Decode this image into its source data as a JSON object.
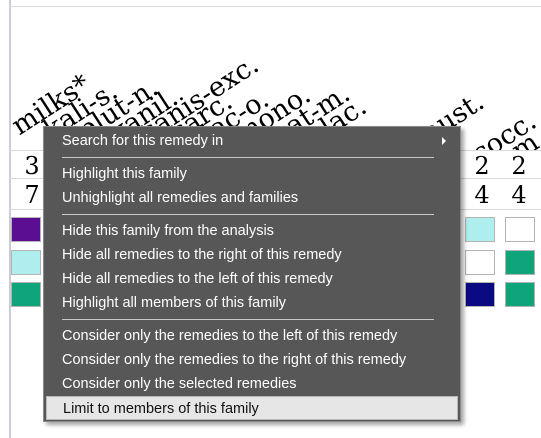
{
  "remedies": [
    "milks*",
    "kali-s.",
    "plut-n.",
    "vanil.",
    "canis-exc.",
    "carc.",
    "lac-o.",
    "mono.",
    "nat-m.",
    "plac.",
    "caust.",
    "cocc.",
    "m"
  ],
  "table": {
    "row1_numbers": [
      "3",
      "2",
      "2"
    ],
    "row2_numbers": [
      "7",
      "4",
      "4"
    ],
    "colors": {
      "purple": "#5b0e91",
      "cyan": "#aeeeee",
      "teal": "#0fa47a",
      "navy": "#0a0a82",
      "white": "#ffffff"
    }
  },
  "context_menu": {
    "items": [
      {
        "label": "Search for this remedy in",
        "submenu": true
      },
      {
        "label": "Highlight this family"
      },
      {
        "label": "Unhighlight all remedies and families"
      },
      {
        "label": "Hide this family from the analysis"
      },
      {
        "label": "Hide all remedies to the right of this remedy"
      },
      {
        "label": "Hide all remedies to the left of this remedy"
      },
      {
        "label": "Highlight all members of this family"
      },
      {
        "label": "Consider only the remedies to the left of this remedy"
      },
      {
        "label": "Consider only the remedies to the right of this remedy"
      },
      {
        "label": "Consider only the selected remedies"
      },
      {
        "label": "Limit to members of this family",
        "highlighted": true
      }
    ]
  }
}
